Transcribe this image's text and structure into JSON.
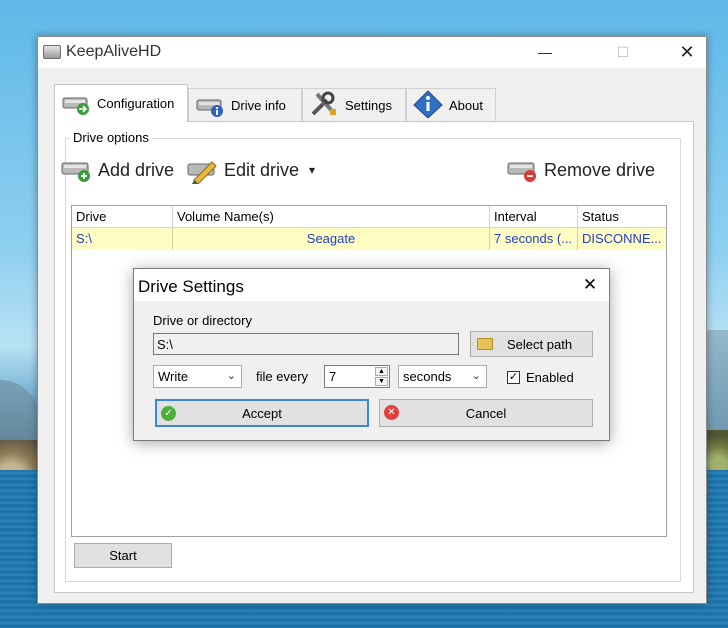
{
  "window": {
    "title": "KeepAliveHD",
    "minimize": "—",
    "maximize": "☐",
    "close": "✕"
  },
  "tabs": [
    {
      "label": "Configuration",
      "icon": "drive-arrow-icon"
    },
    {
      "label": "Drive info",
      "icon": "drive-info-icon"
    },
    {
      "label": "Settings",
      "icon": "tools-icon"
    },
    {
      "label": "About",
      "icon": "info-diamond-icon"
    }
  ],
  "group": {
    "label": "Drive options"
  },
  "toolbar": {
    "add": "Add drive",
    "edit": "Edit drive",
    "edit_arrow": "▾",
    "remove": "Remove drive"
  },
  "grid": {
    "columns": [
      "Drive",
      "Volume Name(s)",
      "Interval",
      "Status"
    ],
    "rows": [
      {
        "drive": "S:\\",
        "volume": "Seagate",
        "interval": "7 seconds (...",
        "status": "DISCONNE..."
      }
    ]
  },
  "start_label": "Start",
  "dialog": {
    "title": "Drive Settings",
    "close": "✕",
    "field_label": "Drive or directory",
    "path": "S:\\",
    "select_path": "Select path",
    "mode": "Write",
    "file_every": "file every",
    "interval": "7",
    "unit": "seconds",
    "enabled_label": "Enabled",
    "enabled_check": "✓",
    "accept": "Accept",
    "cancel": "Cancel",
    "dropdown_arrow": "⌄",
    "spin_up": "▲",
    "spin_down": "▼",
    "ok_glyph": "✓",
    "x_glyph": "✕"
  },
  "colors": {
    "row_highlight": "#fffdc4",
    "row_text": "#1f3fbf",
    "accent": "#3b86d6"
  }
}
